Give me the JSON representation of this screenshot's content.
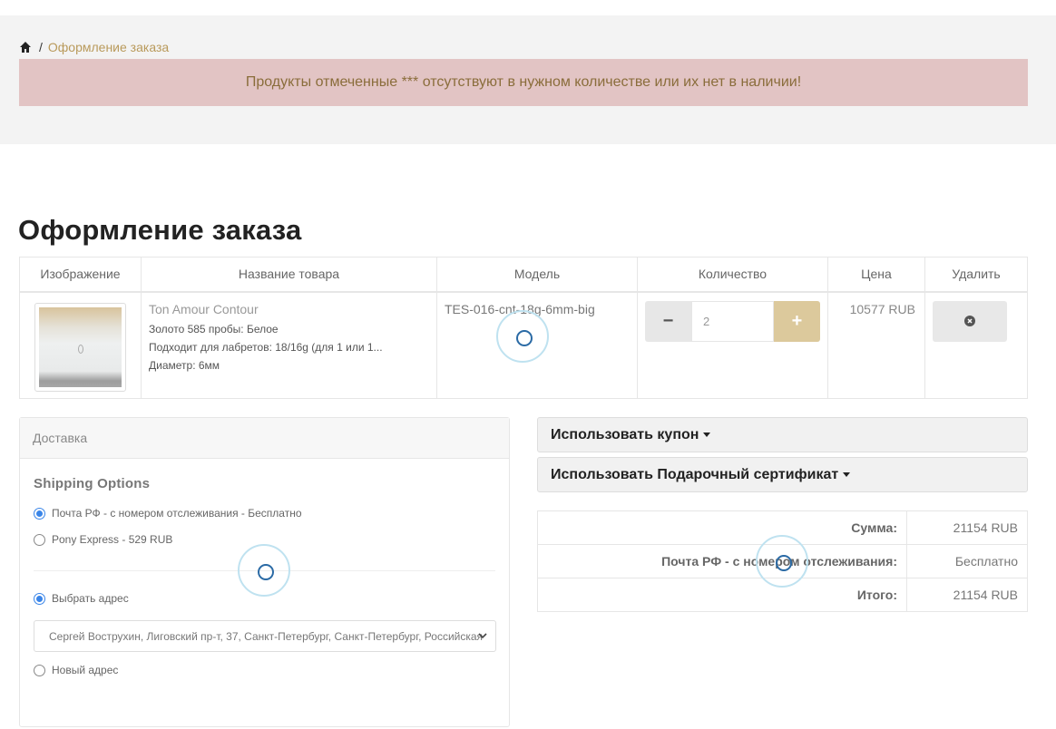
{
  "breadcrumb": {
    "home_icon": "home-icon",
    "separator": "/",
    "current": "Оформление заказа"
  },
  "alert": {
    "text": "Продукты отмеченные *** отсутствуют в нужном количестве или их нет в наличии!"
  },
  "page_title": "Оформление заказа",
  "cart": {
    "headers": [
      "Изображение",
      "Название товара",
      "Модель",
      "Количество",
      "Цена",
      "Удалить"
    ],
    "rows": [
      {
        "name": "Ton Amour Contour",
        "options": [
          "Золото 585 пробы: Белое",
          "Подходит для лабретов: 18/16g (для 1 или 1...",
          "Диаметр: 6мм"
        ],
        "model": "TES-016-cnt-18g-6mm-big",
        "quantity": "2",
        "minus": "−",
        "plus": "+",
        "price": "10577 RUB"
      }
    ]
  },
  "shipping": {
    "panel_title": "Доставка",
    "options_title": "Shipping Options",
    "options": [
      "Почта РФ - с номером отслеживания - Бесплатно",
      "Pony Express - 529 RUB"
    ],
    "selected_option": 0,
    "address_choice_existing": "Выбрать адрес",
    "address_value": "Сергей Вострухин, Лиговский пр-т, 37, Санкт-Петербург, Санкт-Петербург, Российская",
    "address_choice_new": "Новый адрес"
  },
  "accordions": {
    "coupon": "Использовать купон",
    "gift": "Использовать Подарочный сертификат"
  },
  "totals": [
    {
      "label": "Сумма:",
      "value": "21154 RUB"
    },
    {
      "label": "Почта РФ - с номером отслеживания:",
      "value": "Бесплатно"
    },
    {
      "label": "Итого:",
      "value": "21154 RUB"
    }
  ],
  "colors": {
    "accent": "#b99a5b",
    "alert_bg": "#e2c4c4",
    "plus_btn": "#dcc99c",
    "radio": "#3a85e8"
  }
}
